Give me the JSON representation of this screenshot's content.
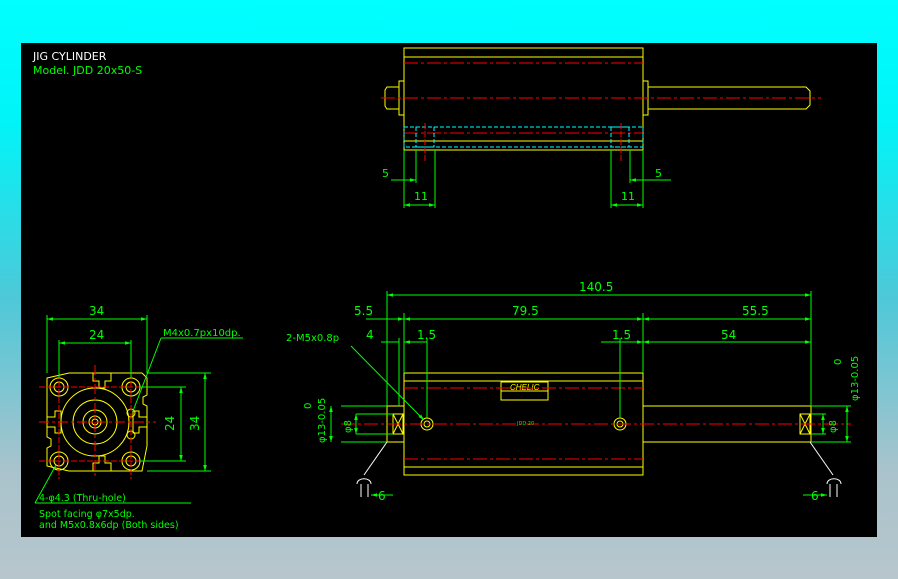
{
  "title": {
    "line1": "JIG CYLINDER",
    "line2": "Model. JDD 20x50-S"
  },
  "top_view": {
    "dims": {
      "left_small": "5",
      "left_width": "11",
      "right_width": "11",
      "right_small": "5"
    }
  },
  "end_view": {
    "dims": {
      "outer_width": "34",
      "inner_width": "24",
      "side_inner": "24",
      "side_outer": "34",
      "thread_note": "M4x0.7px10dp.",
      "hole_note": "4-φ4.3 (Thru-hole)",
      "facing_line1": "Spot facing φ7x5dp.",
      "facing_line2": "and M5x0.8x6dp (Both sides)"
    }
  },
  "side_view": {
    "dims": {
      "overall": "140.5",
      "left_offset": "5.5",
      "body": "79.5",
      "rod": "55.5",
      "port_note": "2-M5x0.8p",
      "port_offset": "4",
      "left_gap": "1.5",
      "right_gap": "1.5",
      "rod_stroke": "54",
      "left_dia": "φ13-0.05",
      "left_dia_zero": "0",
      "left_small_dia": "φ8",
      "right_dia": "φ13-0.05",
      "right_dia_zero": "0",
      "right_small_dia": "φ8",
      "left_bottom": "6",
      "right_bottom": "6"
    },
    "label": {
      "brand": "CHELIC",
      "model_text": "JDD 20"
    }
  },
  "colors": {
    "background": "#000000",
    "outline": "#ffff00",
    "dimension": "#00ff00",
    "centerline": "#ff0000",
    "hidden": "#00ffff",
    "text": "#ffffff"
  }
}
